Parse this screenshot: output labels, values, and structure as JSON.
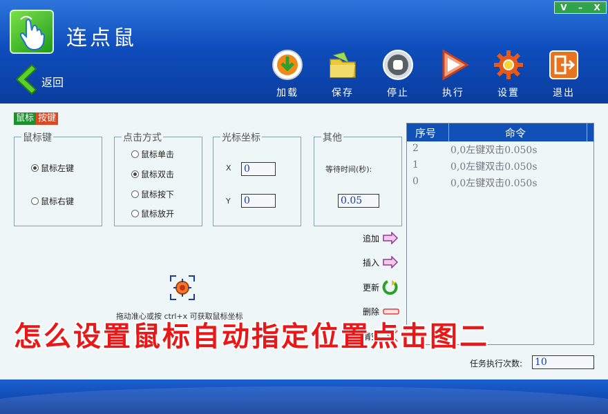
{
  "window": {
    "title": "连点鼠",
    "controls": [
      "V",
      "–",
      "X"
    ]
  },
  "toolbar": {
    "back_label": "返回",
    "buttons": [
      {
        "label": "加载",
        "icon": "download-icon"
      },
      {
        "label": "保存",
        "icon": "folder-icon"
      },
      {
        "label": "停止",
        "icon": "stop-icon"
      },
      {
        "label": "执行",
        "icon": "play-icon"
      },
      {
        "label": "设置",
        "icon": "gear-icon"
      },
      {
        "label": "退出",
        "icon": "exit-icon"
      }
    ]
  },
  "tabs": {
    "mouse": "鼠标",
    "key": "按键"
  },
  "mouse_key": {
    "legend": "鼠标键",
    "left": "鼠标左键",
    "right": "鼠标右键",
    "selected": "left"
  },
  "click_mode": {
    "legend": "点击方式",
    "options": [
      "鼠标单击",
      "鼠标双击",
      "鼠标按下",
      "鼠标放开"
    ],
    "selected_index": 1
  },
  "cursor": {
    "legend": "光标坐标",
    "x_label": "X",
    "y_label": "Y",
    "x_value": "0",
    "y_value": "0"
  },
  "other": {
    "legend": "其他",
    "wait_label": "等待时间(秒):",
    "wait_value": "0.05"
  },
  "crosshair_hint": "拖动准心或按 ctrl+x 可获取鼠标坐标",
  "commands": {
    "add": "追加",
    "insert": "插入",
    "update": "更新",
    "delete": "删除",
    "clear": "清空"
  },
  "table": {
    "headers": [
      "序号",
      "命令"
    ],
    "rows": [
      {
        "index": "2",
        "command": "0,0左键双击0.050s"
      },
      {
        "index": "1",
        "command": "0,0左键双击0.050s"
      },
      {
        "index": "0",
        "command": "0,0左键双击0.050s"
      }
    ]
  },
  "task_count": {
    "label": "任务执行次数:",
    "value": "10"
  },
  "overlay_caption": "怎么设置鼠标自动指定位置点击图二",
  "colors": {
    "header_blue": "#0f4fc0",
    "tab_green": "#1e8f2e",
    "tab_red": "#d84a24",
    "caption_red": "#e81818"
  }
}
